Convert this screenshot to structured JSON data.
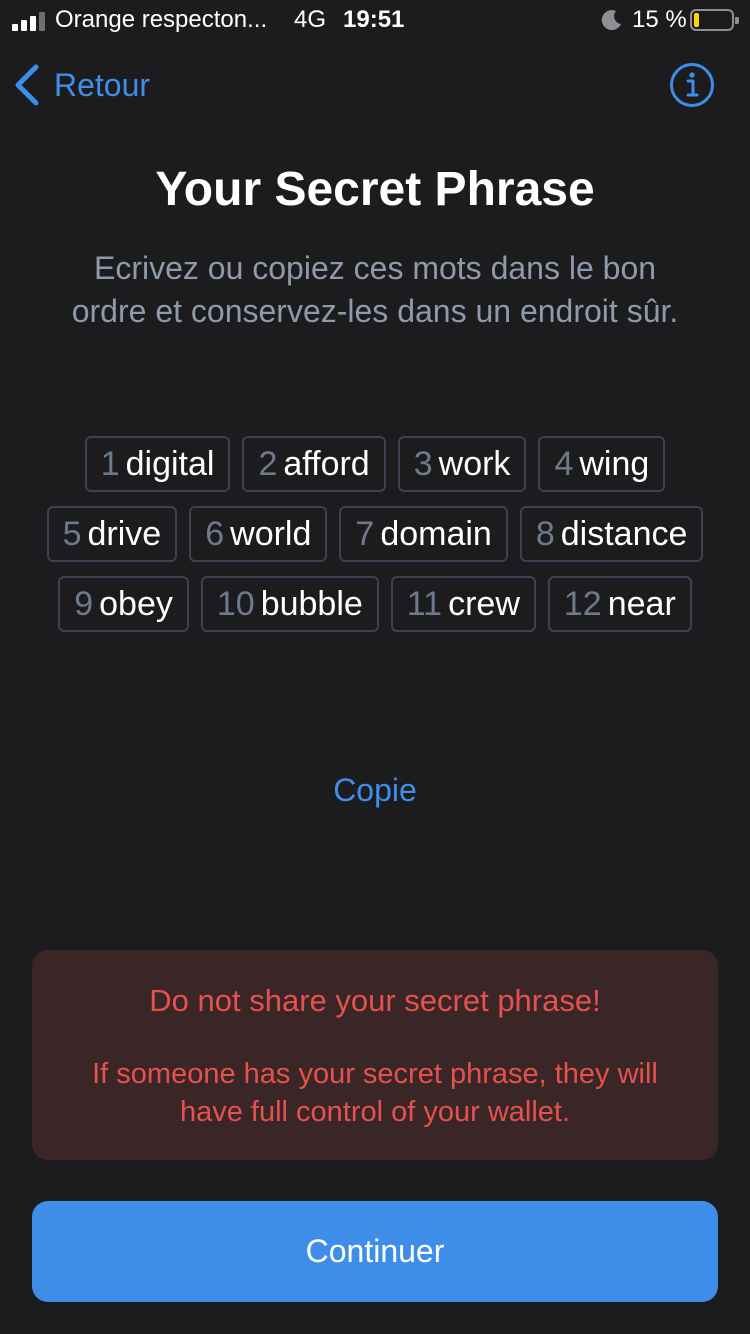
{
  "status_bar": {
    "carrier": "Orange respecton...",
    "network": "4G",
    "time": "19:51",
    "battery": "15 %",
    "battery_level": 0.15,
    "icons": [
      "signal-icon",
      "moon-icon",
      "battery-icon"
    ]
  },
  "nav": {
    "back_label": "Retour",
    "icons": [
      "chevron-left-icon",
      "info-icon"
    ]
  },
  "title": "Your Secret Phrase",
  "description": "Ecrivez ou copiez ces mots dans le bon ordre et conservez-les dans un endroit sûr.",
  "words": [
    {
      "index": "1",
      "word": "digital"
    },
    {
      "index": "2",
      "word": "afford"
    },
    {
      "index": "3",
      "word": "work"
    },
    {
      "index": "4",
      "word": "wing"
    },
    {
      "index": "5",
      "word": "drive"
    },
    {
      "index": "6",
      "word": "world"
    },
    {
      "index": "7",
      "word": "domain"
    },
    {
      "index": "8",
      "word": "distance"
    },
    {
      "index": "9",
      "word": "obey"
    },
    {
      "index": "10",
      "word": "bubble"
    },
    {
      "index": "11",
      "word": "crew"
    },
    {
      "index": "12",
      "word": "near"
    }
  ],
  "copy_label": "Copie",
  "warning": {
    "title": "Do not share your secret phrase!",
    "body": "If someone has your secret phrase, they will have full control of your wallet."
  },
  "continue_label": "Continuer",
  "colors": {
    "accent": "#3e8ee9",
    "background": "#1c1c1e",
    "warning_text": "#e4514e",
    "warning_bg": "#3b2627"
  }
}
